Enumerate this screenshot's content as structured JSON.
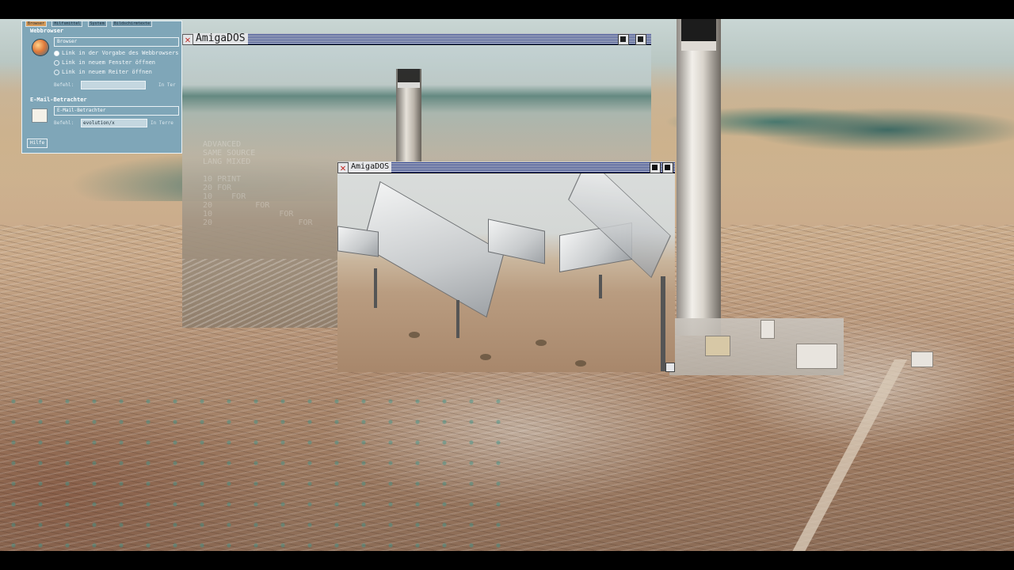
{
  "prefs_window": {
    "tabs": [
      "Browser",
      "Hilfsmittel",
      "System",
      "Bildschirmtexte"
    ],
    "sections": {
      "webbrowser": {
        "heading": "Webbrowser",
        "button": "Browser",
        "options": [
          "Link in der Vorgabe des Webbrowsers öffnen",
          "Link in neuem Fenster öffnen",
          "Link in neuem Reiter öffnen"
        ],
        "selected_index": 0,
        "command_label": "Befehl:",
        "command_value": "",
        "in_front_label": "In Ter"
      },
      "email": {
        "heading": "E-Mail-Betrachter",
        "button": "E-Mail-Betrachter",
        "command_label": "Befehl:",
        "command_value": "evolution/x",
        "in_front_label": "In Terre"
      }
    },
    "help_button": "Hilfe"
  },
  "window_back": {
    "title": "AmigaDOS",
    "ghost_text": "  ADVANCED\n  SAME SOURCE\n  LANG MIXED\n\n  10 PRINT\n  20 FOR\n  10    FOR\n  20         FOR\n  10              FOR\n  20                  FOR"
  },
  "window_front": {
    "title": "AmigaDOS"
  },
  "colors": {
    "prefs_bg": "#7fa6b8",
    "titlebar_stripe": "#2a3e8c",
    "close_gadget": "#c0201a"
  }
}
